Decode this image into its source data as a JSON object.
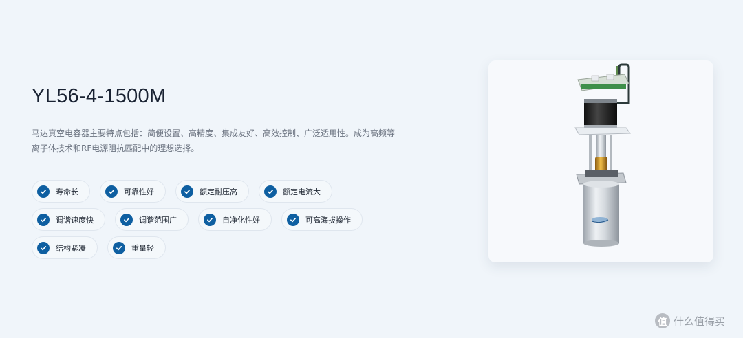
{
  "product": {
    "title": "YL56-4-1500M",
    "description": "马达真空电容器主要特点包括：简便设置、高精度、集成友好、高效控制、广泛适用性。成为高频等离子体技术和RF电源阻抗匹配中的理想选择。"
  },
  "features": {
    "rows": [
      [
        "寿命长",
        "可靠性好",
        "额定耐压高",
        "额定电流大"
      ],
      [
        "调谐速度快",
        "调谐范围广",
        "自净化性好",
        "可高海拔操作"
      ],
      [
        "结构紧凑",
        "重量轻"
      ]
    ]
  },
  "colors": {
    "accent": "#0e5fa1",
    "background": "#f0f5fa"
  },
  "watermark": {
    "badge": "值",
    "text": "什么值得买"
  }
}
